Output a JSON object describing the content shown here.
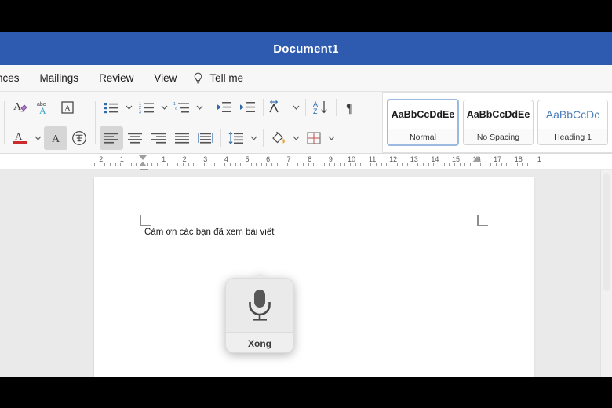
{
  "window": {
    "title": "Document1",
    "title_bar_color": "#2e5bb0"
  },
  "ribbon_tabs": [
    {
      "label": "nces",
      "icon": "",
      "name": "tab-references"
    },
    {
      "label": "Mailings",
      "icon": "",
      "name": "tab-mailings"
    },
    {
      "label": "Review",
      "icon": "",
      "name": "tab-review"
    },
    {
      "label": "View",
      "icon": "",
      "name": "tab-view"
    },
    {
      "label": "Tell me",
      "icon": "lightbulb-icon",
      "name": "tab-tell-me"
    }
  ],
  "ribbon": {
    "font_group": {
      "row1": [
        {
          "name": "clear-formatting-icon",
          "label": "Clear Formatting"
        },
        {
          "name": "spelling-check-icon",
          "label": "Spelling and Grammar"
        },
        {
          "name": "character-border-icon",
          "label": "Character Border"
        }
      ],
      "row2": [
        {
          "name": "font-color-icon",
          "label": "Font Color"
        },
        {
          "name": "text-highlight-icon",
          "label": "Text Highlight Color"
        },
        {
          "name": "phonetic-guide-icon",
          "label": "Phonetic Guide"
        }
      ]
    },
    "paragraph_group": {
      "row1": [
        {
          "name": "bullet-list-icon",
          "label": "Bullets"
        },
        {
          "name": "numbered-list-icon",
          "label": "Numbering"
        },
        {
          "name": "multilevel-list-icon",
          "label": "Multilevel List"
        },
        {
          "name": "decrease-indent-icon",
          "label": "Decrease Indent"
        },
        {
          "name": "increase-indent-icon",
          "label": "Increase Indent"
        },
        {
          "name": "asian-layout-icon",
          "label": "Asian Layout"
        },
        {
          "name": "sort-icon",
          "label": "Sort"
        },
        {
          "name": "show-marks-icon",
          "label": "Show/Hide Paragraph Marks"
        }
      ],
      "row2": [
        {
          "name": "align-left-icon",
          "label": "Align Left",
          "active": true
        },
        {
          "name": "align-center-icon",
          "label": "Center"
        },
        {
          "name": "align-right-icon",
          "label": "Align Right"
        },
        {
          "name": "justify-icon",
          "label": "Justify"
        },
        {
          "name": "distributed-icon",
          "label": "Distributed"
        },
        {
          "name": "line-spacing-icon",
          "label": "Line and Paragraph Spacing"
        },
        {
          "name": "shading-icon",
          "label": "Shading"
        },
        {
          "name": "borders-icon",
          "label": "Borders"
        }
      ]
    }
  },
  "styles_gallery": [
    {
      "preview": "AaBbCcDdEe",
      "label": "Normal",
      "selected": true
    },
    {
      "preview": "AaBbCcDdEe",
      "label": "No Spacing",
      "selected": false
    },
    {
      "preview": "AaBbCcDc",
      "label": "Heading 1",
      "selected": false
    }
  ],
  "ruler": {
    "left_numbers": [
      "2",
      "1"
    ],
    "right_numbers": [
      "1",
      "2",
      "3",
      "4",
      "5",
      "6",
      "7",
      "8",
      "9",
      "10",
      "11",
      "12",
      "13",
      "14",
      "15",
      "16",
      "17",
      "18",
      "1"
    ]
  },
  "document": {
    "body_text": "Cảm ơn các bạn đã xem bài viết"
  },
  "dictation_widget": {
    "icon": "microphone-icon",
    "button_label": "Xong"
  }
}
